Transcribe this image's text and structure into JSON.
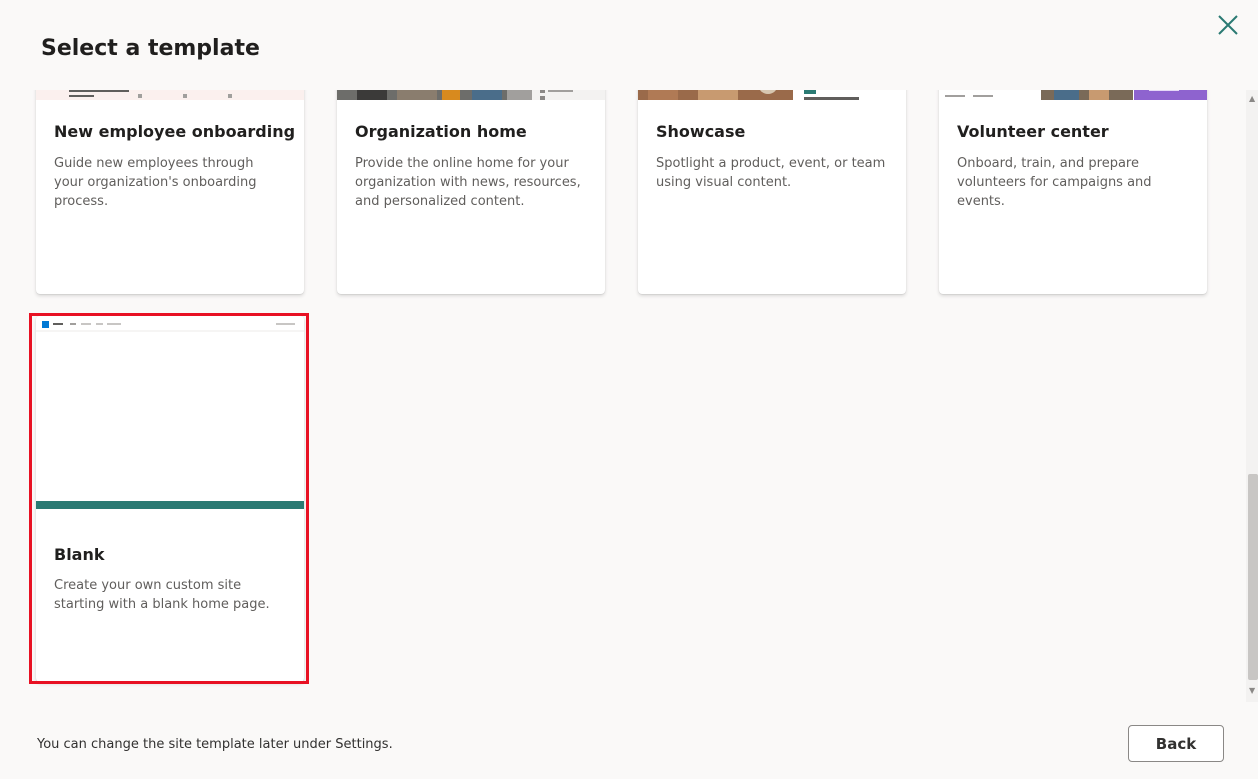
{
  "dialog": {
    "title": "Select a template",
    "footer_note": "You can change the site template later under Settings.",
    "back_label": "Back"
  },
  "templates": [
    {
      "name": "New employee onboarding",
      "description": "Guide new employees through your organization's onboarding process."
    },
    {
      "name": "Organization home",
      "description": "Provide the online home for your organization with news, resources, and personalized content."
    },
    {
      "name": "Showcase",
      "description": "Spotlight a product, event, or team using visual content."
    },
    {
      "name": "Volunteer center",
      "description": "Onboard, train, and prepare volunteers for campaigns and events."
    },
    {
      "name": "Blank",
      "description": "Create your own custom site starting with a blank home page.",
      "selected": true
    }
  ],
  "colors": {
    "accent": "#2a7a73",
    "selection": "#e81123",
    "close_icon": "#2a7a73"
  }
}
